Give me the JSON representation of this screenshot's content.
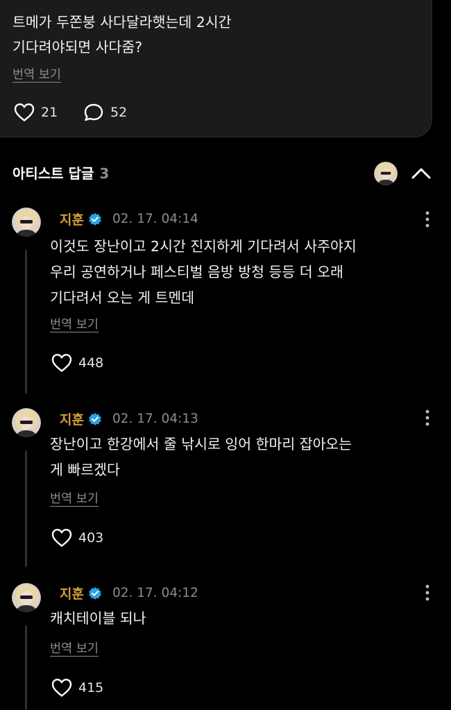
{
  "post": {
    "lines": [
      "트메가 두쫀붕 사다달라햇는데 2시간",
      "기다려야되면 사다줌?"
    ],
    "translate_label": "번역 보기",
    "likes": "21",
    "comments": "52"
  },
  "replies_section": {
    "title": "아티스트 답글",
    "count": "3"
  },
  "replies": [
    {
      "author": "지훈",
      "time": "02. 17. 04:14",
      "lines": [
        "이것도 장난이고 2시간 진지하게 기다려서 사주야지",
        "우리 공연하거나 페스티벌 음방 방청 등등 더 오래",
        "기다려서 오는 게 트멘데"
      ],
      "translate_label": "번역 보기",
      "likes": "448"
    },
    {
      "author": "지훈",
      "time": "02. 17. 04:13",
      "lines": [
        "장난이고 한강에서 줄 낚시로 잉어 한마리 잡아오는",
        "게 빠르겠다"
      ],
      "translate_label": "번역 보기",
      "likes": "403"
    },
    {
      "author": "지훈",
      "time": "02. 17. 04:12",
      "lines": [
        "캐치테이블 되나"
      ],
      "translate_label": "번역 보기",
      "likes": "415"
    }
  ],
  "colors": {
    "background": "#000000",
    "card": "#1b1b1b",
    "author": "#d4a037",
    "verified": "#29a3e6",
    "muted": "#8d8d8d"
  },
  "icons": {
    "like": "heart-outline-icon",
    "comment": "speech-bubble-icon",
    "verified": "verified-badge-icon",
    "more": "kebab-menu-icon",
    "collapse": "chevron-up-icon"
  }
}
